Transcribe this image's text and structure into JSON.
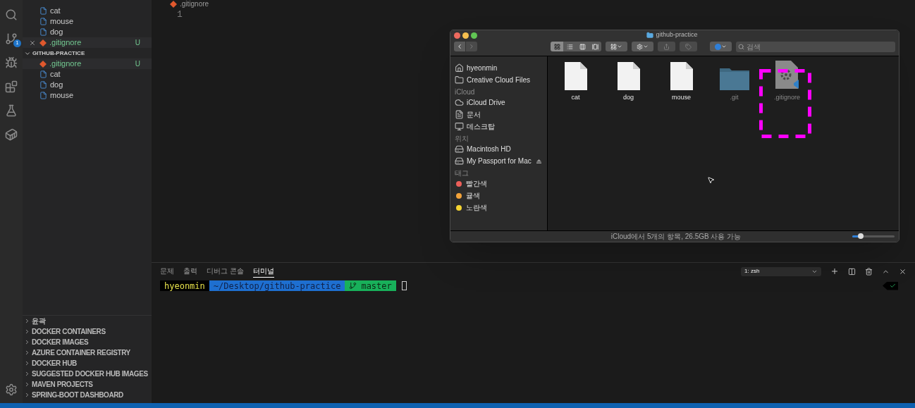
{
  "activity_bar": {
    "scm_badge": "1"
  },
  "open_editors": [
    {
      "name": "cat",
      "kind": "file",
      "selected": false
    },
    {
      "name": "mouse",
      "kind": "file",
      "selected": false
    },
    {
      "name": "dog",
      "kind": "file",
      "selected": false
    },
    {
      "name": ".gitignore",
      "kind": "git",
      "status": "U",
      "selected": true
    }
  ],
  "workspace": {
    "title": "GITHUB-PRACTICE",
    "expanded": true,
    "items": [
      {
        "name": ".gitignore",
        "kind": "git",
        "status": "U",
        "selected": true
      },
      {
        "name": "cat",
        "kind": "file",
        "selected": false
      },
      {
        "name": "dog",
        "kind": "file",
        "selected": false
      },
      {
        "name": "mouse",
        "kind": "file",
        "selected": false
      }
    ]
  },
  "editor": {
    "tab": ".gitignore",
    "line_numbers": [
      "1"
    ]
  },
  "finder": {
    "title": "github-practice",
    "search_placeholder": "검색",
    "sections": [
      {
        "items": [
          {
            "label": "hyeonmin",
            "kind": "home"
          },
          {
            "label": "Creative Cloud Files",
            "kind": "folder"
          }
        ]
      },
      {
        "heading": "iCloud",
        "items": [
          {
            "label": "iCloud Drive",
            "kind": "cloud"
          },
          {
            "label": "문서",
            "kind": "document"
          },
          {
            "label": "데스크탑",
            "kind": "desktop"
          }
        ]
      },
      {
        "heading": "위치",
        "items": [
          {
            "label": "Macintosh HD",
            "kind": "disk"
          },
          {
            "label": "My Passport for Mac",
            "kind": "disk",
            "ejectable": true
          }
        ]
      },
      {
        "heading": "태그",
        "items": [
          {
            "label": "빨간색",
            "kind": "tag",
            "color": "#ec5f5a"
          },
          {
            "label": "귤색",
            "kind": "tag",
            "color": "#f3a33a"
          },
          {
            "label": "노란색",
            "kind": "tag",
            "color": "#f5d431"
          }
        ]
      }
    ],
    "files": [
      {
        "name": "cat",
        "kind": "document",
        "hidden": false
      },
      {
        "name": "dog",
        "kind": "document",
        "hidden": false
      },
      {
        "name": "mouse",
        "kind": "document",
        "hidden": false
      },
      {
        "name": ".git",
        "kind": "folder",
        "hidden": true
      },
      {
        "name": ".gitignore",
        "kind": "config",
        "hidden": true
      }
    ],
    "status": "iCloud에서 5개의 항목, 26.5GB 사용 가능",
    "zoom": {
      "level": 0.2
    }
  },
  "panel": {
    "tabs": [
      {
        "label": "문제",
        "selected": false
      },
      {
        "label": "출력",
        "selected": false
      },
      {
        "label": "디버그 콘솔",
        "selected": false
      },
      {
        "label": "터미널",
        "selected": true
      }
    ],
    "terminal_select": "1: zsh",
    "prompt": [
      {
        "kind": "user",
        "text": "hyeonmin"
      },
      {
        "kind": "path",
        "text": "~/Desktop/github-practice"
      },
      {
        "kind": "git",
        "text": "master"
      }
    ]
  },
  "sections": [
    "윤곽",
    "DOCKER CONTAINERS",
    "DOCKER IMAGES",
    "AZURE CONTAINER REGISTRY",
    "DOCKER HUB",
    "SUGGESTED DOCKER HUB IMAGES",
    "MAVEN PROJECTS",
    "SPRING-BOOT DASHBOARD"
  ]
}
